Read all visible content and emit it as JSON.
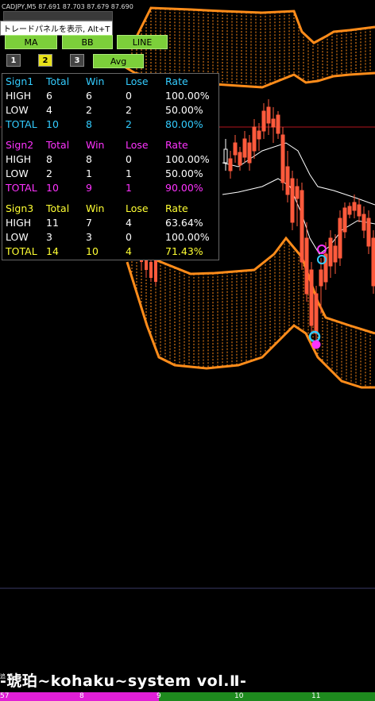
{
  "window": {
    "symbol_info": "CADJPY,M5  87.691 87.703 87.679 87.690"
  },
  "tooltip": {
    "text": "トレードパネルを表示, Alt+T"
  },
  "toolbar": {
    "buttons": [
      "MA",
      "BB",
      "LINE"
    ],
    "numbers": [
      "1",
      "2",
      "3"
    ],
    "avg_label": "Avg"
  },
  "stats": {
    "headers": [
      "Total",
      "Win",
      "Lose",
      "Rate"
    ],
    "sign1": {
      "name": "Sign1",
      "rows": [
        {
          "label": "HIGH",
          "total": "6",
          "win": "6",
          "lose": "0",
          "rate": "100.00%"
        },
        {
          "label": "LOW",
          "total": "4",
          "win": "2",
          "lose": "2",
          "rate": "50.00%"
        },
        {
          "label": "TOTAL",
          "total": "10",
          "win": "8",
          "lose": "2",
          "rate": "80.00%"
        }
      ]
    },
    "sign2": {
      "name": "Sign2",
      "rows": [
        {
          "label": "HIGH",
          "total": "8",
          "win": "8",
          "lose": "0",
          "rate": "100.00%"
        },
        {
          "label": "LOW",
          "total": "2",
          "win": "1",
          "lose": "1",
          "rate": "50.00%"
        },
        {
          "label": "TOTAL",
          "total": "10",
          "win": "9",
          "lose": "1",
          "rate": "90.00%"
        }
      ]
    },
    "sign3": {
      "name": "Sign3",
      "rows": [
        {
          "label": "HIGH",
          "total": "11",
          "win": "7",
          "lose": "4",
          "rate": "63.64%"
        },
        {
          "label": "LOW",
          "total": "3",
          "win": "3",
          "lose": "0",
          "rate": "100.00%"
        },
        {
          "label": "TOTAL",
          "total": "14",
          "win": "10",
          "lose": "4",
          "rate": "71.43%"
        }
      ]
    }
  },
  "brand": {
    "title": "-琥珀~kohaku~system vol.Ⅱ-",
    "small_prefix": "追 近"
  },
  "time_axis": {
    "labels": [
      "57",
      "8",
      "9",
      "10",
      "11"
    ]
  },
  "colors": {
    "band": "#ff8c1a",
    "bull": "#ffffff",
    "bear": "#ff5a3c",
    "sign1": "#33ccff",
    "sign2": "#ff33ff",
    "sign3": "#ffff33",
    "hline": "#b4141e"
  }
}
